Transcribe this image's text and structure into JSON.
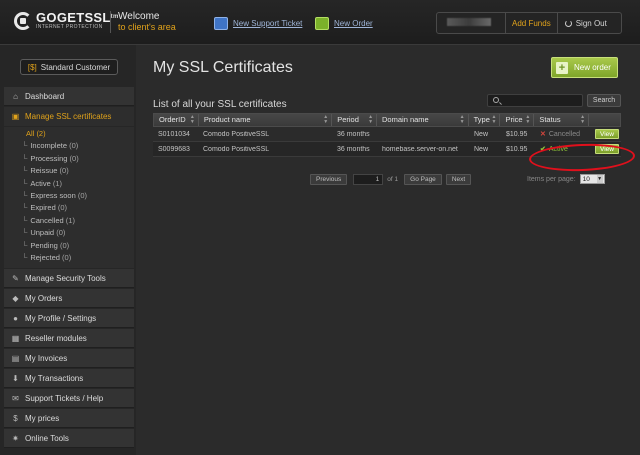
{
  "header": {
    "logo_name": "GOGETSSL",
    "logo_tm": "tm",
    "logo_sub": "INTERNET PROTECTION",
    "welcome": "Welcome",
    "welcome_sub": "to client's area",
    "new_ticket": "New Support Ticket",
    "new_order": "New Order",
    "add_funds": "Add Funds",
    "sign_out": "Sign Out",
    "accent_color": "#e0a21b"
  },
  "sidebar": {
    "customer_prefix": "[$]",
    "customer_type": "Standard Customer",
    "dashboard": "Dashboard",
    "manage_ssl": "Manage SSL certificates",
    "sub_items": [
      {
        "label": "All",
        "count": "(2)"
      },
      {
        "label": "Incomplete",
        "count": "(0)"
      },
      {
        "label": "Processing",
        "count": "(0)"
      },
      {
        "label": "Reissue",
        "count": "(0)"
      },
      {
        "label": "Active",
        "count": "(1)"
      },
      {
        "label": "Express soon",
        "count": "(0)"
      },
      {
        "label": "Expired",
        "count": "(0)"
      },
      {
        "label": "Cancelled",
        "count": "(1)"
      },
      {
        "label": "Unpaid",
        "count": "(0)"
      },
      {
        "label": "Pending",
        "count": "(0)"
      },
      {
        "label": "Rejected",
        "count": "(0)"
      }
    ],
    "items": [
      {
        "label": "Manage Security Tools",
        "icon": "wrench-icon"
      },
      {
        "label": "My Orders",
        "icon": "tag-icon"
      },
      {
        "label": "My Profile / Settings",
        "icon": "user-icon"
      },
      {
        "label": "Reseller modules",
        "icon": "module-icon"
      },
      {
        "label": "My Invoices",
        "icon": "document-icon"
      },
      {
        "label": "My Transactions",
        "icon": "download-icon"
      },
      {
        "label": "Support Tickets / Help",
        "icon": "chat-icon"
      },
      {
        "label": "My prices",
        "icon": "dollar-icon"
      },
      {
        "label": "Online Tools",
        "icon": "gear-icon"
      }
    ]
  },
  "main": {
    "title": "My SSL Certificates",
    "new_order_button": "New order",
    "list_title": "List of all your SSL certificates",
    "search_placeholder": "",
    "search_button": "Search",
    "columns": [
      "OrderID",
      "Product name",
      "Period",
      "Domain name",
      "Type",
      "Price",
      "Status"
    ],
    "rows": [
      {
        "order_id": "S0101034",
        "product": "Comodo PositiveSSL",
        "period": "36 months",
        "domain": "",
        "type": "New",
        "price": "$10.95",
        "status": "Cancelled",
        "action": "View"
      },
      {
        "order_id": "S0099683",
        "product": "Comodo PositiveSSL",
        "period": "36 months",
        "domain": "homebase.server-on.net",
        "type": "New",
        "price": "$10.95",
        "status": "Active",
        "action": "View"
      }
    ],
    "pager": {
      "previous": "Previous",
      "page": "1",
      "of_text": "of 1",
      "go": "Go Page",
      "next": "Next"
    },
    "items_per_page_label": "Items per page:",
    "items_per_page_value": "10",
    "status_colors": {
      "active": "#8fc43a",
      "cancelled": "#d8463d"
    },
    "highlight_color": "#e0101c"
  }
}
